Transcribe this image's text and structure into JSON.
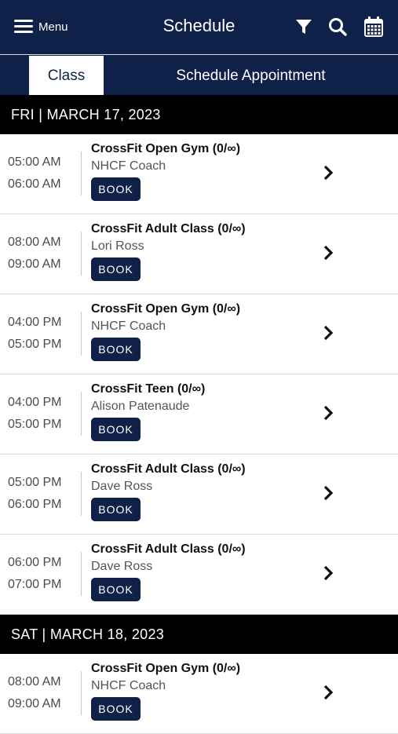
{
  "header": {
    "menu_label": "Menu",
    "title": "Schedule",
    "icons": [
      "filter-icon",
      "search-icon",
      "calendar-icon"
    ]
  },
  "tabs": [
    {
      "label": "Class",
      "active": true
    },
    {
      "label": "Schedule Appointment",
      "active": false
    }
  ],
  "colors": {
    "navy": "#0f2148",
    "black": "#000000",
    "white": "#ffffff"
  },
  "days": [
    {
      "header": "FRI | MARCH 17, 2023",
      "classes": [
        {
          "start": "05:00 AM",
          "end": "06:00 AM",
          "name": "CrossFit Open Gym (0/∞)",
          "coach": "NHCF Coach",
          "button": "BOOK"
        },
        {
          "start": "08:00 AM",
          "end": "09:00 AM",
          "name": "CrossFit Adult Class (0/∞)",
          "coach": "Lori Ross",
          "button": "BOOK"
        },
        {
          "start": "04:00 PM",
          "end": "05:00 PM",
          "name": "CrossFit Open Gym (0/∞)",
          "coach": "NHCF Coach",
          "button": "BOOK"
        },
        {
          "start": "04:00 PM",
          "end": "05:00 PM",
          "name": "CrossFit Teen (0/∞)",
          "coach": "Alison Patenaude",
          "button": "BOOK"
        },
        {
          "start": "05:00 PM",
          "end": "06:00 PM",
          "name": "CrossFit Adult Class (0/∞)",
          "coach": "Dave Ross",
          "button": "BOOK"
        },
        {
          "start": "06:00 PM",
          "end": "07:00 PM",
          "name": "CrossFit Adult Class (0/∞)",
          "coach": "Dave Ross",
          "button": "BOOK"
        }
      ]
    },
    {
      "header": "SAT | MARCH 18, 2023",
      "classes": [
        {
          "start": "08:00 AM",
          "end": "09:00 AM",
          "name": "CrossFit Open Gym (0/∞)",
          "coach": "NHCF Coach",
          "button": "BOOK"
        }
      ]
    }
  ]
}
